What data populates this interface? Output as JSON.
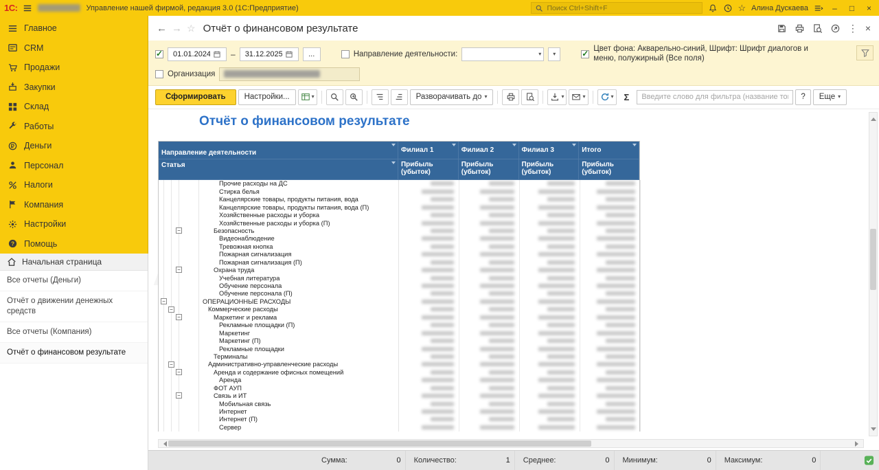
{
  "colors": {
    "brand_yellow": "#f8ca0c",
    "filter_panel_yellow": "#fdf5d2",
    "table_header_blue": "#35679a",
    "report_title_blue": "#2d72c8",
    "generate_button_yellow": "#fdd22e",
    "checkbox_check_green": "#1d7a1d",
    "status_indicator_green": "#58b158"
  },
  "titlebar": {
    "logo": "1С:",
    "app_title": "Управление нашей фирмой, редакция 3.0  (1С:Предприятие)",
    "search_placeholder": "Поиск Ctrl+Shift+F",
    "user_name": "Алина Дускаева"
  },
  "sidebar": {
    "sections": [
      {
        "id": "main",
        "icon": "menu",
        "label": "Главное"
      },
      {
        "id": "crm",
        "icon": "card",
        "label": "CRM"
      },
      {
        "id": "sales",
        "icon": "cart",
        "label": "Продажи"
      },
      {
        "id": "purchases",
        "icon": "box-in",
        "label": "Закупки"
      },
      {
        "id": "warehouse",
        "icon": "grid",
        "label": "Склад"
      },
      {
        "id": "works",
        "icon": "wrench",
        "label": "Работы"
      },
      {
        "id": "money",
        "icon": "coin",
        "label": "Деньги"
      },
      {
        "id": "staff",
        "icon": "person",
        "label": "Персонал"
      },
      {
        "id": "taxes",
        "icon": "percent",
        "label": "Налоги"
      },
      {
        "id": "company",
        "icon": "flag",
        "label": "Компания"
      },
      {
        "id": "settings",
        "icon": "gear",
        "label": "Настройки"
      },
      {
        "id": "help",
        "icon": "help",
        "label": "Помощь"
      }
    ],
    "home": {
      "label": "Начальная страница"
    },
    "links": [
      {
        "id": "all-reports-money",
        "label": "Все отчеты (Деньги)",
        "active": false
      },
      {
        "id": "cash-flow-report",
        "label": "Отчёт о движении денежных средств",
        "active": false
      },
      {
        "id": "all-reports-company",
        "label": "Все отчеты (Компания)",
        "active": false
      },
      {
        "id": "financial-result-report",
        "label": "Отчёт о финансовом результате",
        "active": true
      }
    ]
  },
  "page": {
    "title": "Отчёт о финансовом результате"
  },
  "filters": {
    "period": {
      "checked": true,
      "from": "01.01.2024",
      "to": "31.12.2025",
      "separator": "–",
      "more_button": "..."
    },
    "direction": {
      "checked": false,
      "label": "Направление деятельности:",
      "value": ""
    },
    "style": {
      "checked": true,
      "label": "Цвет фона: Акварельно-синий, Шрифт: Шрифт диалогов и меню, полужирный (Все поля)"
    },
    "organization": {
      "checked": false,
      "label": "Организация"
    }
  },
  "toolbar": {
    "generate": "Сформировать",
    "settings": "Настройки...",
    "expand_to": "Разворачивать до",
    "sigma": "Σ",
    "filter_placeholder": "Введите слово для фильтра (название тов",
    "help": "?",
    "more": "Еще"
  },
  "report": {
    "title": "Отчёт о финансовом результате",
    "watermark": "AUDIX",
    "header": {
      "dim": "Направление деятельности",
      "article": "Статья",
      "columns": [
        "Филиал 1",
        "Филиал 2",
        "Филиал 3",
        "Итого"
      ],
      "measure": "Прибыль (убыток)"
    },
    "rows": [
      {
        "level": 3,
        "label": "Прочие расходы на ДС"
      },
      {
        "level": 3,
        "label": "Стирка белья"
      },
      {
        "level": 3,
        "label": "Канцелярские товары, продукты питания, вода"
      },
      {
        "level": 3,
        "label": "Канцелярские товары, продукты питания, вода (П)"
      },
      {
        "level": 3,
        "label": "Хозяйственные расходы и уборка"
      },
      {
        "level": 3,
        "label": "Хозяйственные расходы и уборка (П)"
      },
      {
        "level": 2,
        "label": "Безопасность",
        "group": true
      },
      {
        "level": 3,
        "label": "Видеонаблюдение"
      },
      {
        "level": 3,
        "label": "Тревожная кнопка"
      },
      {
        "level": 3,
        "label": "Пожарная сигнализация"
      },
      {
        "level": 3,
        "label": "Пожарная сигнализация (П)"
      },
      {
        "level": 2,
        "label": "Охрана труда",
        "group": true
      },
      {
        "level": 3,
        "label": "Учебная литература"
      },
      {
        "level": 3,
        "label": "Обучение персонала"
      },
      {
        "level": 3,
        "label": "Обучение персонала (П)"
      },
      {
        "level": 0,
        "label": "ОПЕРАЦИОННЫЕ РАСХОДЫ",
        "group": true
      },
      {
        "level": 1,
        "label": "Коммерческие расходы",
        "group": true
      },
      {
        "level": 2,
        "label": "Маркетинг и реклама",
        "group": true
      },
      {
        "level": 3,
        "label": "Рекламные площадки (П)"
      },
      {
        "level": 3,
        "label": "Маркетинг"
      },
      {
        "level": 3,
        "label": "Маркетинг (П)"
      },
      {
        "level": 3,
        "label": "Рекламные площадки"
      },
      {
        "level": 2,
        "label": "Терминалы"
      },
      {
        "level": 1,
        "label": "Административно-управленческие расходы",
        "group": true
      },
      {
        "level": 2,
        "label": "Аренда и содержание офисных помещений",
        "group": true
      },
      {
        "level": 3,
        "label": "Аренда"
      },
      {
        "level": 2,
        "label": "ФОТ АУП"
      },
      {
        "level": 2,
        "label": "Связь и ИТ",
        "group": true
      },
      {
        "level": 3,
        "label": "Мобильная связь"
      },
      {
        "level": 3,
        "label": "Интернет"
      },
      {
        "level": 3,
        "label": "Интернет (П)"
      },
      {
        "level": 3,
        "label": "Сервер"
      }
    ]
  },
  "statusbar": {
    "items": [
      {
        "id": "sum",
        "label": "Сумма:",
        "value": "0"
      },
      {
        "id": "count",
        "label": "Количество:",
        "value": "1"
      },
      {
        "id": "avg",
        "label": "Среднее:",
        "value": "0"
      },
      {
        "id": "min",
        "label": "Минимум:",
        "value": "0"
      },
      {
        "id": "max",
        "label": "Максимум:",
        "value": "0"
      }
    ]
  }
}
